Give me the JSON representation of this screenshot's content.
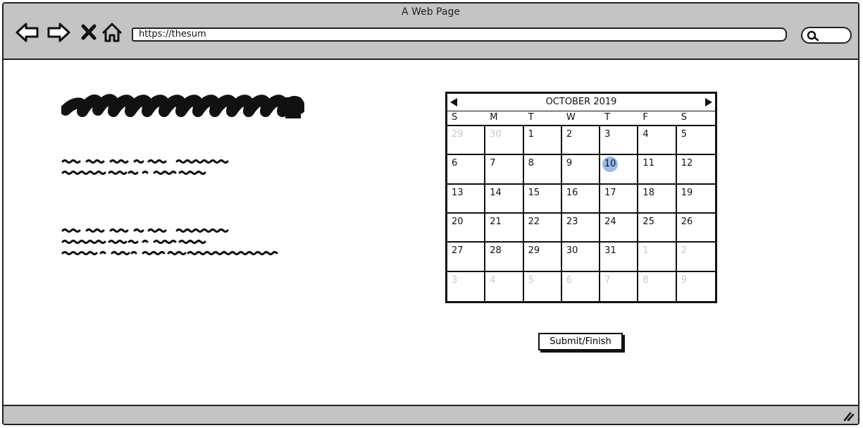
{
  "window": {
    "title": "A Web Page",
    "url": "https://thesum"
  },
  "icons": {
    "back": "back-arrow-icon",
    "forward": "forward-arrow-icon",
    "stop": "close-icon",
    "home": "home-icon",
    "search": "search-icon",
    "resize": "resize-grip-icon"
  },
  "content": {
    "headline": "",
    "paragraph_1": "",
    "paragraph_2": ""
  },
  "calendar": {
    "month_label": "OCTOBER 2019",
    "weekdays": [
      "S",
      "M",
      "T",
      "W",
      "T",
      "F",
      "S"
    ],
    "days": [
      {
        "d": "29",
        "muted": true
      },
      {
        "d": "30",
        "muted": true
      },
      {
        "d": "1"
      },
      {
        "d": "2"
      },
      {
        "d": "3"
      },
      {
        "d": "4"
      },
      {
        "d": "5"
      },
      {
        "d": "6"
      },
      {
        "d": "7"
      },
      {
        "d": "8"
      },
      {
        "d": "9"
      },
      {
        "d": "10",
        "selected": true
      },
      {
        "d": "11"
      },
      {
        "d": "12"
      },
      {
        "d": "13"
      },
      {
        "d": "14"
      },
      {
        "d": "15"
      },
      {
        "d": "16"
      },
      {
        "d": "17"
      },
      {
        "d": "18"
      },
      {
        "d": "19"
      },
      {
        "d": "20"
      },
      {
        "d": "21"
      },
      {
        "d": "22"
      },
      {
        "d": "23"
      },
      {
        "d": "24"
      },
      {
        "d": "25"
      },
      {
        "d": "26"
      },
      {
        "d": "27"
      },
      {
        "d": "28"
      },
      {
        "d": "29"
      },
      {
        "d": "30"
      },
      {
        "d": "31"
      },
      {
        "d": "1",
        "muted": true
      },
      {
        "d": "2",
        "muted": true
      },
      {
        "d": "3",
        "muted": true
      },
      {
        "d": "4",
        "muted": true
      },
      {
        "d": "5",
        "muted": true
      },
      {
        "d": "6",
        "muted": true
      },
      {
        "d": "7",
        "muted": true
      },
      {
        "d": "8",
        "muted": true
      },
      {
        "d": "9",
        "muted": true
      }
    ],
    "selected_color": "#9ab8ea"
  },
  "form": {
    "submit_label": "Submit/Finish"
  },
  "colors": {
    "chrome": "#c4c4c4",
    "ink": "#111111"
  }
}
